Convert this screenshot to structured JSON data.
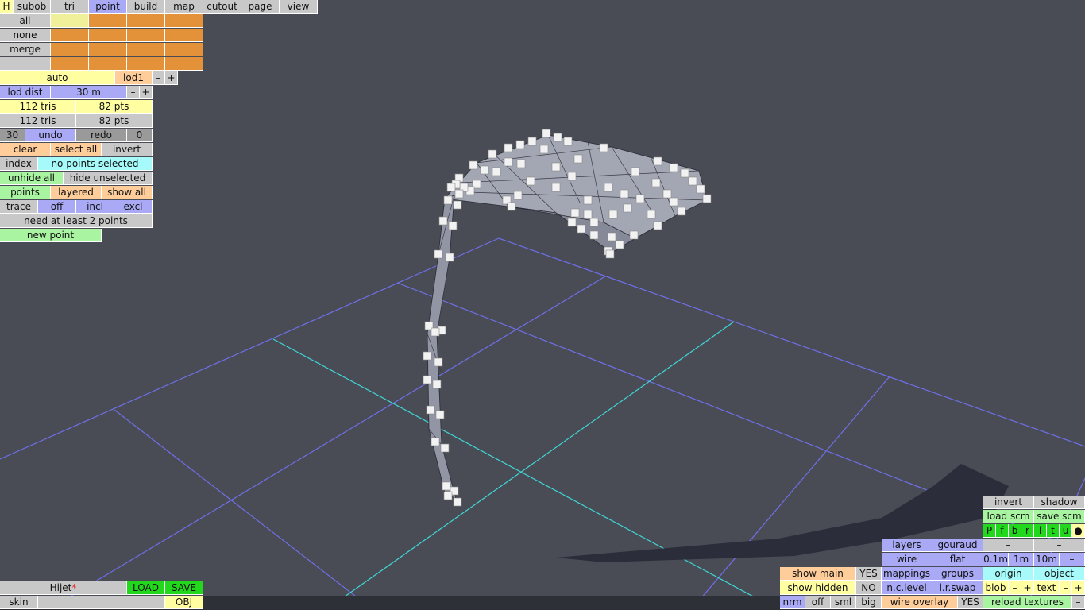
{
  "top_menu": {
    "h": "H",
    "items": [
      "subob",
      "tri",
      "point",
      "build",
      "map",
      "cutout",
      "page",
      "view"
    ],
    "active": "point"
  },
  "select_ops": [
    "all",
    "none",
    "merge",
    "–"
  ],
  "lod": {
    "auto": "auto",
    "level": "lod1",
    "minus": "–",
    "plus": "+",
    "dist_label": "lod dist",
    "dist_value": "30 m"
  },
  "stats": {
    "tris_1": "112 tris",
    "pts_1": "82 pts",
    "tris_2": "112 tris",
    "pts_2": "82 pts"
  },
  "history": {
    "undo_count": "30",
    "undo": "undo",
    "redo": "redo",
    "redo_count": "0"
  },
  "selection": {
    "clear": "clear",
    "select_all": "select all",
    "invert": "invert",
    "index": "index",
    "status": "no points selected"
  },
  "visibility": {
    "unhide_all": "unhide all",
    "hide_unselected": "hide unselected",
    "points": "points",
    "layered": "layered",
    "show_all": "show all"
  },
  "trace": {
    "trace": "trace",
    "off": "off",
    "incl": "incl",
    "excl": "excl",
    "hint": "need at least 2 points",
    "new_point": "new point"
  },
  "file": {
    "name": "Hijet",
    "modified": "*",
    "load": "LOAD",
    "save": "SAVE",
    "skin": "skin",
    "obj": "OBJ"
  },
  "display": {
    "show_main": "show main",
    "show_main_val": "YES",
    "show_hidden": "show hidden",
    "show_hidden_val": "NO",
    "nrm": "nrm",
    "off": "off",
    "sml": "sml",
    "big": "big",
    "layers": "layers",
    "gouraud": "gouraud",
    "wire": "wire",
    "flat": "flat",
    "mappings": "mappings",
    "groups": "groups",
    "nc_level": "n.c.level",
    "lr_swap": "l.r.swap",
    "wire_overlay": "wire overlay",
    "wire_overlay_val": "YES"
  },
  "scene": {
    "invert": "invert",
    "shadow": "shadow",
    "load_scm": "load scm",
    "save_scm": "save scm",
    "views": [
      "P",
      "f",
      "b",
      "r",
      "l",
      "t",
      "u"
    ],
    "dot": "●",
    "dash1": "–",
    "dash2": "–",
    "grid": [
      "0.1m",
      "1m",
      "10m",
      "–"
    ],
    "origin": "origin",
    "object": "object",
    "blob": "blob",
    "minus": "–",
    "plus": "+",
    "text": "text",
    "reload": "reload textures",
    "reload_minus": "–"
  },
  "colors": {
    "background": "#4a4c55",
    "grid": "#6f6fe8",
    "axis": "#3fd6d6",
    "mesh": "#a0a3b0",
    "handles": "#f2f2f2"
  }
}
